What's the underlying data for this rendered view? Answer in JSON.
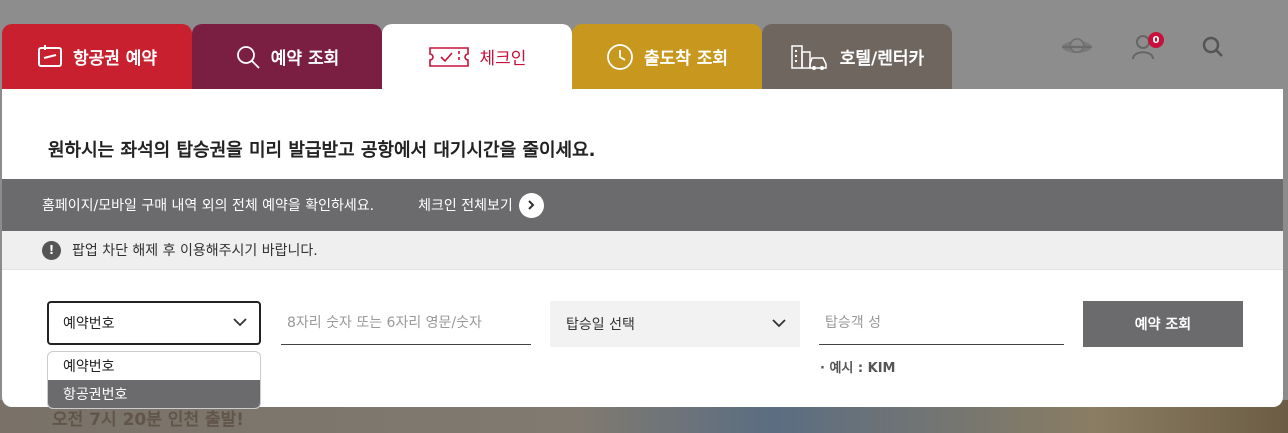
{
  "tabs": [
    {
      "label": "항공권 예약",
      "icon": "ticket-icon"
    },
    {
      "label": "예약 조회",
      "icon": "search-icon"
    },
    {
      "label": "체크인",
      "icon": "boarding-pass-icon"
    },
    {
      "label": "출도착 조회",
      "icon": "clock-icon"
    },
    {
      "label": "호텔/렌터카",
      "icon": "hotel-car-icon"
    }
  ],
  "header": {
    "notification_count": "0"
  },
  "checkin": {
    "headline": "원하시는 좌석의 탑승권을 미리 발급받고 공항에서 대기시간을 줄이세요.",
    "info_text": "홈페이지/모바일 구매 내역 외의 전체 예약을 확인하세요.",
    "view_all_label": "체크인 전체보기",
    "notice_text": "팝업 차단 해제 후 이용해주시기 바랍니다.",
    "search_type": {
      "selected": "예약번호",
      "options": [
        "예약번호",
        "항공권번호"
      ]
    },
    "reservation_placeholder": "8자리 숫자 또는 6자리 영문/숫자",
    "date_select_label": "탑승일 선택",
    "surname_placeholder": "탑승객 성",
    "example_text": "·  예시 :  KIM",
    "search_button": "예약 조회"
  },
  "colors": {
    "booking_tab": "#c8202f",
    "lookup_tab": "#7a1e42",
    "checkin_accent": "#c6123a",
    "status_tab": "#c8981e",
    "hotel_tab": "#6f6660",
    "bar_gray": "#6b6b6e"
  },
  "background_banner": "오전 7시 20분 인천 출발!"
}
